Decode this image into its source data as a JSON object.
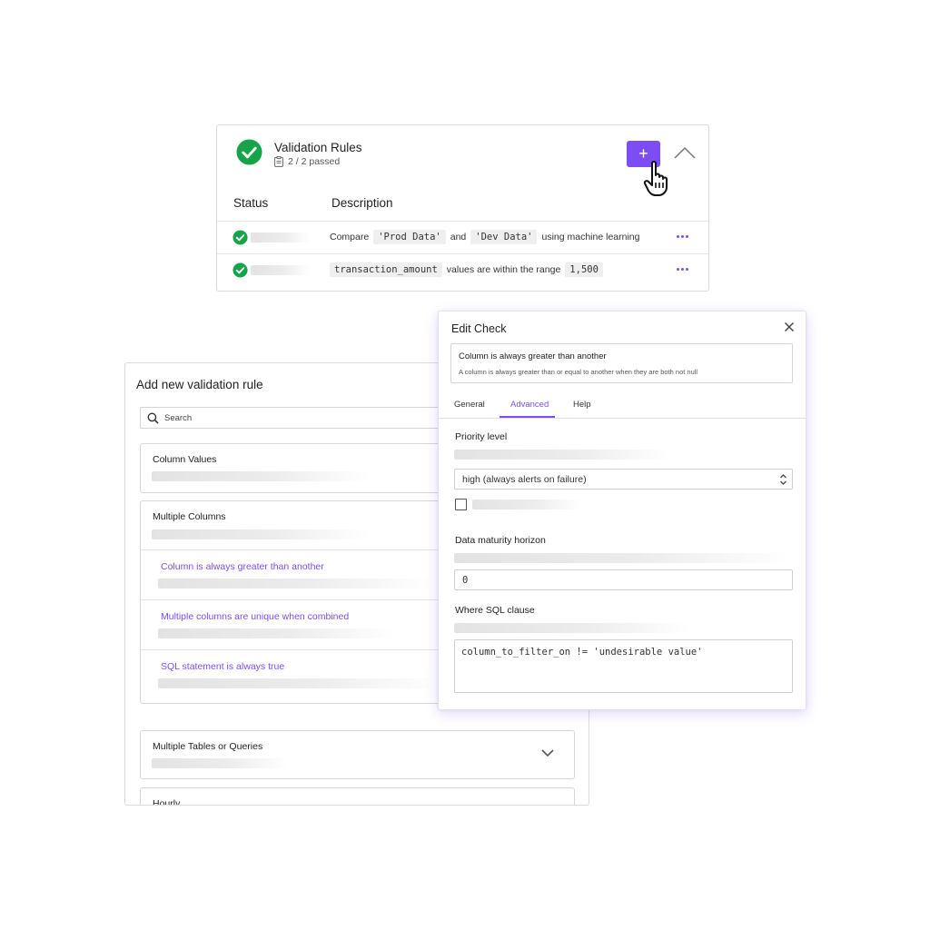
{
  "rules_card": {
    "title": "Validation Rules",
    "passed": "2 / 2 passed",
    "add_label": "+",
    "columns": {
      "status": "Status",
      "description": "Description"
    },
    "rows": [
      {
        "status": "passed",
        "parts": [
          "Compare",
          "'Prod Data'",
          "and",
          "'Dev Data'",
          "using machine learning"
        ]
      },
      {
        "status": "passed",
        "parts": [
          "transaction_amount",
          "values are within the range",
          "1,500"
        ]
      }
    ]
  },
  "add_panel": {
    "title": "Add new validation rule",
    "search_placeholder": "Search",
    "groups": {
      "column_values": "Column Values",
      "multiple_columns": "Multiple Columns",
      "multiple_tables": "Multiple Tables or Queries",
      "hourly": "Hourly"
    },
    "multiple_columns_items": [
      "Column is always greater than another",
      "Multiple columns are unique when combined",
      "SQL statement is always true"
    ]
  },
  "edit_check": {
    "title": "Edit Check",
    "check_name": "Column is always greater than another",
    "check_description": "A column is always greater than or equal to another when they are both not null",
    "tabs": [
      "General",
      "Advanced",
      "Help"
    ],
    "active_tab": "Advanced",
    "priority_label": "Priority level",
    "priority_value": "high (always alerts on failure)",
    "checkbox_checked": false,
    "maturity_label": "Data maturity horizon",
    "maturity_value": "0",
    "where_label": "Where SQL clause",
    "where_value": "column_to_filter_on != 'undesirable value'"
  },
  "colors": {
    "accent": "#7c4df2",
    "success": "#16a34a"
  },
  "icons": [
    "check-circle-icon",
    "clipboard-icon",
    "chevron-up-icon",
    "hand-pointer-icon",
    "more-dots-icon",
    "search-icon",
    "chevron-down-icon",
    "close-icon",
    "select-arrows-icon"
  ]
}
